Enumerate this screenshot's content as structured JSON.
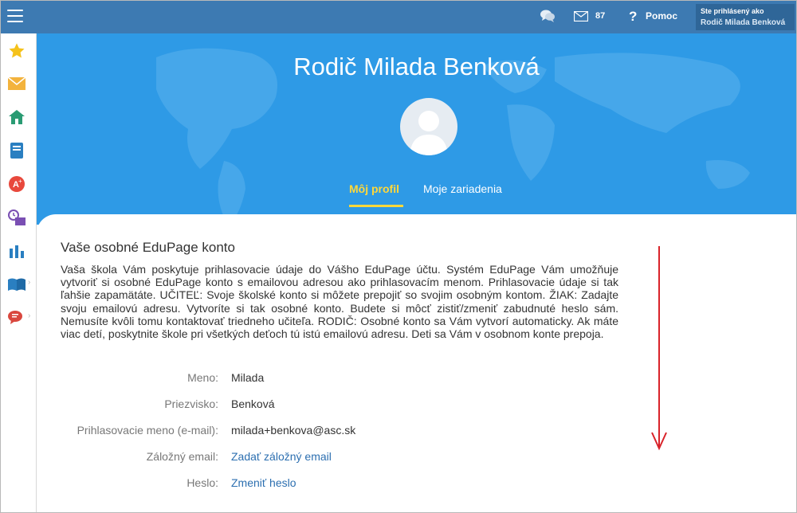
{
  "topbar": {
    "mail_count": "87",
    "help_label": "Pomoc",
    "logged_in_label": "Ste prihlásený ako",
    "logged_in_user": "Rodič Milada Benková"
  },
  "sidebar": {
    "items": [
      {
        "icon": "star-icon",
        "color": "#f5c21b"
      },
      {
        "icon": "envelope-icon",
        "color": "#f3b33d"
      },
      {
        "icon": "home-icon",
        "color": "#2a9b73"
      },
      {
        "icon": "notebook-icon",
        "color": "#2a7fc1"
      },
      {
        "icon": "grade-icon",
        "color": "#e8483c"
      },
      {
        "icon": "calendar-icon",
        "color": "#7a4fb3"
      },
      {
        "icon": "bar-chart-icon",
        "color": "#2a7fc1"
      },
      {
        "icon": "open-book-icon",
        "color": "#2a7fc1"
      },
      {
        "icon": "chat-bubbles-icon",
        "color": "#d9473e"
      }
    ]
  },
  "hero": {
    "title": "Rodič Milada Benková",
    "tabs": [
      {
        "label": "Môj profil",
        "active": true
      },
      {
        "label": "Moje zariadenia",
        "active": false
      }
    ]
  },
  "content": {
    "heading": "Vaše osobné EduPage konto",
    "paragraph": "Vaša škola Vám poskytuje prihlasovacie údaje do Vášho EduPage účtu. Systém EduPage Vám umožňuje vytvoriť si osobné EduPage konto s emailovou adresou ako prihlasovacím menom. Prihlasovacie údaje si tak ľahšie zapamätáte. UČITEĽ: Svoje školské konto si môžete prepojiť so svojim osobným kontom. ŽIAK: Zadajte svoju emailovú adresu. Vytvoríte si tak osobné konto. Budete si môcť zistiť/zmeniť zabudnuté heslo sám. Nemusíte kvôli tomu kontaktovať triedneho učiteľa. RODIČ: Osobné konto sa Vám vytvorí automaticky. Ak máte viac detí, poskytnite škole pri všetkých deťoch tú istú emailovú adresu. Deti sa Vám v osobnom konte prepoja.",
    "fields": [
      {
        "label": "Meno:",
        "value": "Milada"
      },
      {
        "label": "Priezvisko:",
        "value": "Benková"
      },
      {
        "label": "Prihlasovacie meno (e-mail):",
        "value": "milada+benkova@asc.sk"
      },
      {
        "label": "Záložný email:",
        "value": "Zadať záložný email"
      },
      {
        "label": "Heslo:",
        "value": "Zmeniť heslo"
      }
    ]
  },
  "colors": {
    "topbar": "#3d7ab2",
    "hero": "#2e9ae6",
    "tab_active": "#ffd83a",
    "link": "#2c6fb0",
    "annotation_arrow": "#d9232a"
  }
}
